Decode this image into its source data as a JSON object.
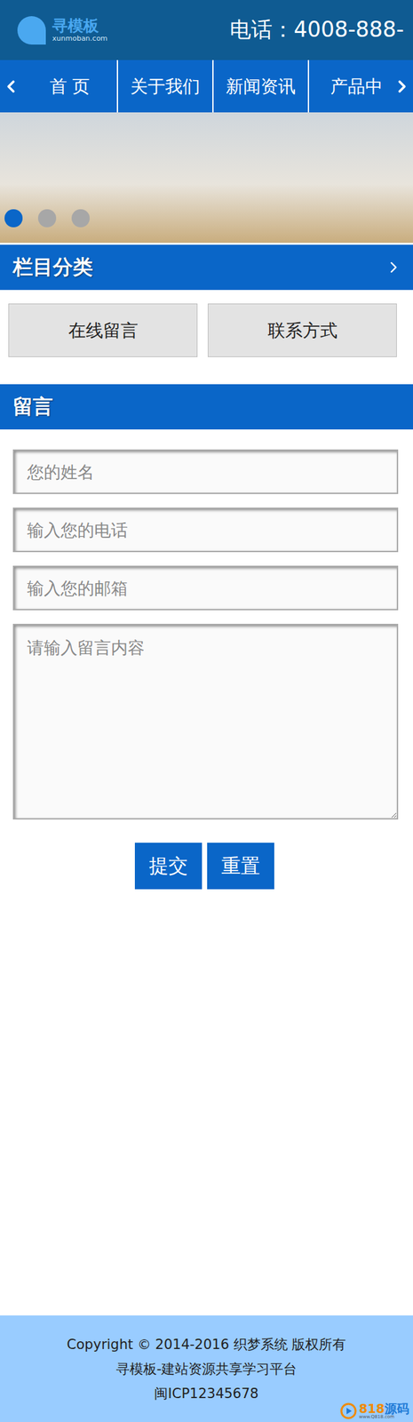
{
  "header": {
    "logo": {
      "name": "寻模板",
      "domain": "xunmoban.com"
    },
    "phone": "电话：4008-888-"
  },
  "nav": {
    "items": [
      {
        "label": "首 页",
        "selected": false
      },
      {
        "label": "关于我们",
        "selected": false
      },
      {
        "label": "新闻资讯",
        "selected": false
      },
      {
        "label": "产品中",
        "selected": false
      }
    ]
  },
  "banner": {
    "slides": [
      {
        "selected": true
      },
      {
        "selected": false
      },
      {
        "selected": false
      }
    ]
  },
  "category": {
    "title": "栏目分类",
    "links": [
      "在线留言",
      "联系方式"
    ]
  },
  "message": {
    "title": "留言",
    "fields": [
      {
        "kind": "input",
        "placeholder": "您的姓名"
      },
      {
        "kind": "input",
        "placeholder": "输入您的电话"
      },
      {
        "kind": "input",
        "placeholder": "输入您的邮箱"
      },
      {
        "kind": "textarea",
        "placeholder": "请输入留言内容"
      }
    ],
    "buttons": [
      "提交",
      "重置"
    ]
  },
  "footer": {
    "lines": [
      "Copyright © 2014-2016 织梦系统 版权所有",
      "寻模板-建站资源共享学习平台",
      "闽ICP12345678"
    ]
  },
  "watermark": {
    "number": "818",
    "word": "源码",
    "url": "www.Q818.com"
  }
}
